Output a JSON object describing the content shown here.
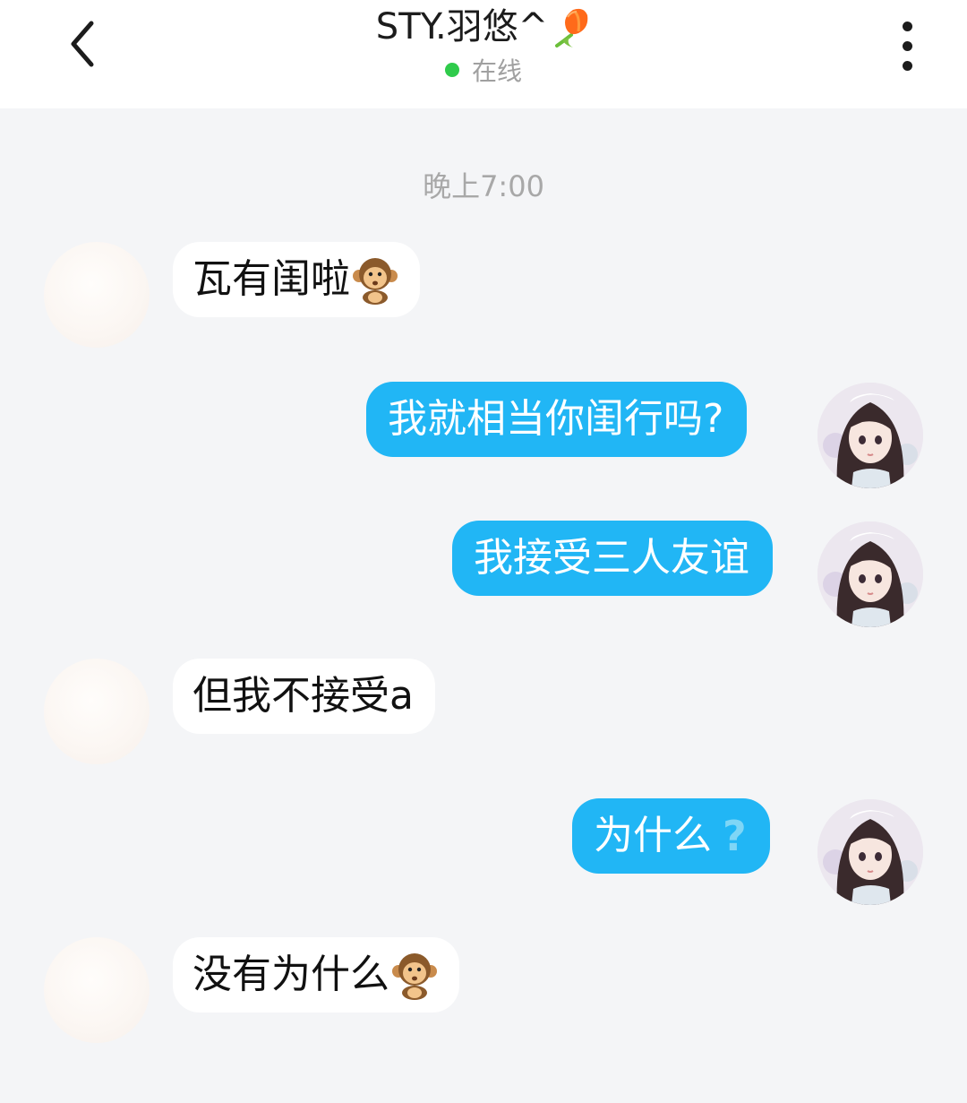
{
  "header": {
    "title": "STY.羽悠^",
    "title_emoji": "tulip-icon",
    "status_text": "在线",
    "status_color": "#2fcb4b"
  },
  "chat": {
    "timestamp": "晚上7:00",
    "messages": [
      {
        "side": "in",
        "text": "瓦有闺啦",
        "emoji": "monkey-icon"
      },
      {
        "side": "out",
        "text": "我就相当你闺行吗?"
      },
      {
        "side": "out",
        "text": "我接受三人友谊"
      },
      {
        "side": "in",
        "text": "但我不接受a"
      },
      {
        "side": "out",
        "text": "为什么",
        "suffix": "?"
      },
      {
        "side": "in",
        "text": "没有为什么",
        "emoji": "monkey-icon"
      }
    ]
  },
  "colors": {
    "outgoing_bubble": "#21b6f5",
    "incoming_bubble": "#ffffff",
    "background": "#f4f5f7"
  }
}
